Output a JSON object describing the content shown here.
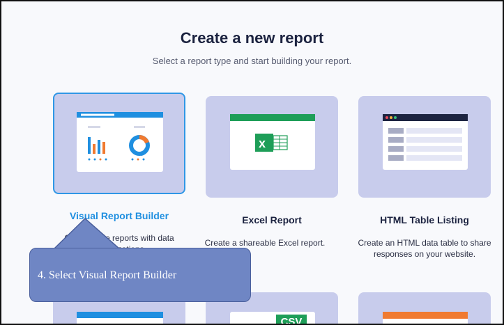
{
  "page": {
    "title": "Create a new report",
    "subtitle": "Select a report type and start building your report."
  },
  "cards": [
    {
      "label": "Visual Report Builder",
      "desc": "Create table reports with data visualizations",
      "icon": "chart-dashboard-icon",
      "selected": true
    },
    {
      "label": "Excel Report",
      "desc": "Create a shareable Excel report.",
      "icon": "excel-icon"
    },
    {
      "label": "HTML Table Listing",
      "desc": "Create an HTML data table to share responses on your website.",
      "icon": "html-table-icon"
    }
  ],
  "bottom_row": {
    "csv_label": "CSV"
  },
  "callout": {
    "text": "4. Select Visual Report Builder"
  },
  "colors": {
    "accent": "#1f8fe0",
    "card_bg": "#c8ccec",
    "excel_green": "#1e9e58",
    "navy": "#1c2340",
    "callout": "#6f86c4",
    "orange": "#f07a30"
  }
}
